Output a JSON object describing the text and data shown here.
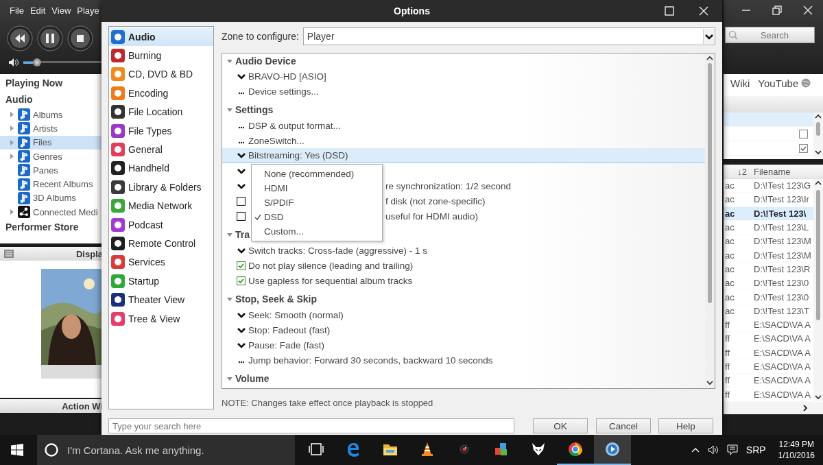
{
  "player": {
    "menu": [
      "File",
      "Edit",
      "View",
      "Playe"
    ],
    "volume": {
      "level": 0.17
    },
    "tree": [
      {
        "kind": "header",
        "label": "Playing Now"
      },
      {
        "kind": "header",
        "label": "Audio"
      },
      {
        "kind": "music",
        "label": "Albums",
        "expandable": true,
        "selected": false
      },
      {
        "kind": "music",
        "label": "Artists",
        "expandable": true,
        "selected": false
      },
      {
        "kind": "music",
        "label": "Files",
        "expandable": true,
        "selected": true
      },
      {
        "kind": "music",
        "label": "Genres",
        "expandable": true,
        "selected": false
      },
      {
        "kind": "music",
        "label": "Panes",
        "expandable": false,
        "selected": false
      },
      {
        "kind": "music",
        "label": "Recent Albums",
        "expandable": false,
        "selected": false
      },
      {
        "kind": "music",
        "label": "3D Albums",
        "expandable": false,
        "selected": false
      },
      {
        "kind": "network",
        "label": "Connected Medi",
        "expandable": true,
        "selected": false
      },
      {
        "kind": "header",
        "label": "Performer Store"
      }
    ],
    "display_title": "Displa",
    "art": {
      "kind": "picture"
    },
    "action_title": "Action Wi",
    "search": {
      "placeholder": "Search"
    },
    "links": [
      {
        "label": "Wiki",
        "icon": false
      },
      {
        "label": "YouTube",
        "icon": true
      }
    ],
    "list": [
      {
        "kind": "blank",
        "selected": true
      },
      {
        "kind": "checkbox",
        "selected": false,
        "checked": false
      },
      {
        "kind": "checkbox",
        "selected": false,
        "checked": true
      }
    ],
    "table": {
      "columns": [
        "↓2",
        "Filename"
      ],
      "rows": [
        {
          "column_1": "ac",
          "filename": "D:\\!Test 123\\G",
          "selected": false
        },
        {
          "column_1": "ac",
          "filename": "D:\\!Test 123\\Ir",
          "selected": false
        },
        {
          "column_1": "ac",
          "filename": "D:\\!Test 123\\",
          "selected": true
        },
        {
          "column_1": "ac",
          "filename": "D:\\!Test 123\\L",
          "selected": false
        },
        {
          "column_1": "ac",
          "filename": "D:\\!Test 123\\M",
          "selected": false
        },
        {
          "column_1": "ac",
          "filename": "D:\\!Test 123\\M",
          "selected": false
        },
        {
          "column_1": "ac",
          "filename": "D:\\!Test 123\\R",
          "selected": false
        },
        {
          "column_1": "ac",
          "filename": "D:\\!Test 123\\0",
          "selected": false
        },
        {
          "column_1": "ac",
          "filename": "D:\\!Test 123\\0",
          "selected": false
        },
        {
          "column_1": "ac",
          "filename": "D:\\!Test 123\\T",
          "selected": false
        },
        {
          "column_1": "ff",
          "filename": "E:\\SACD\\VA A",
          "selected": false
        },
        {
          "column_1": "ff",
          "filename": "E:\\SACD\\VA A",
          "selected": false
        },
        {
          "column_1": "ff",
          "filename": "E:\\SACD\\VA A",
          "selected": false
        },
        {
          "column_1": "ff",
          "filename": "E:\\SACD\\VA A",
          "selected": false
        },
        {
          "column_1": "ff",
          "filename": "E:\\SACD\\VA A",
          "selected": false
        },
        {
          "column_1": "ff",
          "filename": "E:\\SACD\\VA A",
          "selected": false
        }
      ]
    }
  },
  "dialog": {
    "title": "Options",
    "categories": [
      {
        "label": "Audio",
        "color": "#1e6fd0",
        "selected": true
      },
      {
        "label": "Burning",
        "color": "#c0282d",
        "selected": false
      },
      {
        "label": "CD, DVD & BD",
        "color": "#f08a1c",
        "selected": false
      },
      {
        "label": "Encoding",
        "color": "#f07b1c",
        "selected": false
      },
      {
        "label": "File Location",
        "color": "#333333",
        "selected": false
      },
      {
        "label": "File Types",
        "color": "#9b38c8",
        "selected": false
      },
      {
        "label": "General",
        "color": "#e0405a",
        "selected": false
      },
      {
        "label": "Handheld",
        "color": "#222222",
        "selected": false
      },
      {
        "label": "Library & Folders",
        "color": "#3a3a3a",
        "selected": false
      },
      {
        "label": "Media Network",
        "color": "#3aa83a",
        "selected": false
      },
      {
        "label": "Podcast",
        "color": "#a23ad0",
        "selected": false
      },
      {
        "label": "Remote Control",
        "color": "#1f1f1f",
        "selected": false
      },
      {
        "label": "Services",
        "color": "#d93a3a",
        "selected": false
      },
      {
        "label": "Startup",
        "color": "#2fa83a",
        "selected": false
      },
      {
        "label": "Theater View",
        "color": "#1a2f80",
        "selected": false
      },
      {
        "label": "Tree & View",
        "color": "#e0406a",
        "selected": false
      }
    ],
    "zone": {
      "label": "Zone to configure:",
      "value": "Player"
    },
    "sections": [
      {
        "title": "Audio Device",
        "expanded": true,
        "items": [
          {
            "kind": "choice",
            "label": "BRAVO-HD [ASIO]",
            "selected": false
          },
          {
            "kind": "dialog",
            "label": "Device settings...",
            "selected": false
          }
        ]
      },
      {
        "title": "Settings",
        "expanded": true,
        "items": [
          {
            "kind": "dialog",
            "label": "DSP & output format...",
            "selected": false
          },
          {
            "kind": "dialog",
            "label": "ZoneSwitch...",
            "selected": false
          },
          {
            "kind": "choice",
            "label": "Bitstreaming: Yes (DSD)",
            "selected": true
          },
          {
            "kind": "choice",
            "selected": false
          },
          {
            "kind": "choice",
            "label": "re synchronization: 1/2 second",
            "clipped": true,
            "selected": false
          },
          {
            "kind": "checkbox",
            "checked": false,
            "label": "f disk (not zone-specific)",
            "clipped": true,
            "selected": false
          },
          {
            "kind": "checkbox",
            "checked": false,
            "label": "useful for HDMI audio)",
            "clipped": true,
            "selected": false
          }
        ]
      },
      {
        "title": "Tra",
        "expanded": true,
        "items": [
          {
            "kind": "choice",
            "label": "Switch tracks: Cross-fade (aggressive) - 1 s",
            "selected": false
          },
          {
            "kind": "checkbox",
            "checked": true,
            "label": "Do not play silence (leading and trailing)",
            "selected": false
          },
          {
            "kind": "checkbox",
            "checked": true,
            "label": "Use gapless for sequential album tracks",
            "selected": false
          }
        ]
      },
      {
        "title": "Stop, Seek & Skip",
        "expanded": true,
        "items": [
          {
            "kind": "choice",
            "label": "Seek: Smooth (normal)",
            "selected": false
          },
          {
            "kind": "choice",
            "label": "Stop: Fadeout (fast)",
            "selected": false
          },
          {
            "kind": "choice",
            "label": "Pause: Fade (fast)",
            "selected": false
          },
          {
            "kind": "dialog",
            "label": "Jump behavior: Forward 30 seconds, backward 10 seconds",
            "selected": false
          }
        ]
      },
      {
        "title": "Volume",
        "expanded": true
      }
    ],
    "bitstream_menu": [
      {
        "label": "None (recommended)",
        "checked": false
      },
      {
        "label": "HDMI",
        "checked": false
      },
      {
        "label": "S/PDIF",
        "checked": false
      },
      {
        "label": "DSD",
        "checked": true
      },
      {
        "label": "Custom...",
        "checked": false
      }
    ],
    "note": "NOTE: Changes take effect once playback is stopped",
    "search": {
      "placeholder": "Type your search here"
    },
    "buttons": [
      "OK",
      "Cancel",
      "Help"
    ]
  },
  "taskbar": {
    "cortana": "I'm Cortana. Ask me anything.",
    "apps": [
      {
        "kind": "task-view",
        "running": false,
        "active": false
      },
      {
        "kind": "browser",
        "running": false,
        "active": false
      },
      {
        "kind": "folder",
        "running": false,
        "active": false
      },
      {
        "kind": "cone",
        "running": false,
        "active": false
      },
      {
        "kind": "lens",
        "running": false,
        "active": false
      },
      {
        "kind": "blocks",
        "running": false,
        "active": false
      },
      {
        "kind": "fox",
        "running": false,
        "active": false
      },
      {
        "kind": "ring",
        "running": true,
        "active": false
      },
      {
        "kind": "player",
        "running": true,
        "active": true
      }
    ],
    "language": "SRP",
    "time": "12:49 PM",
    "date": "1/10/2016"
  }
}
